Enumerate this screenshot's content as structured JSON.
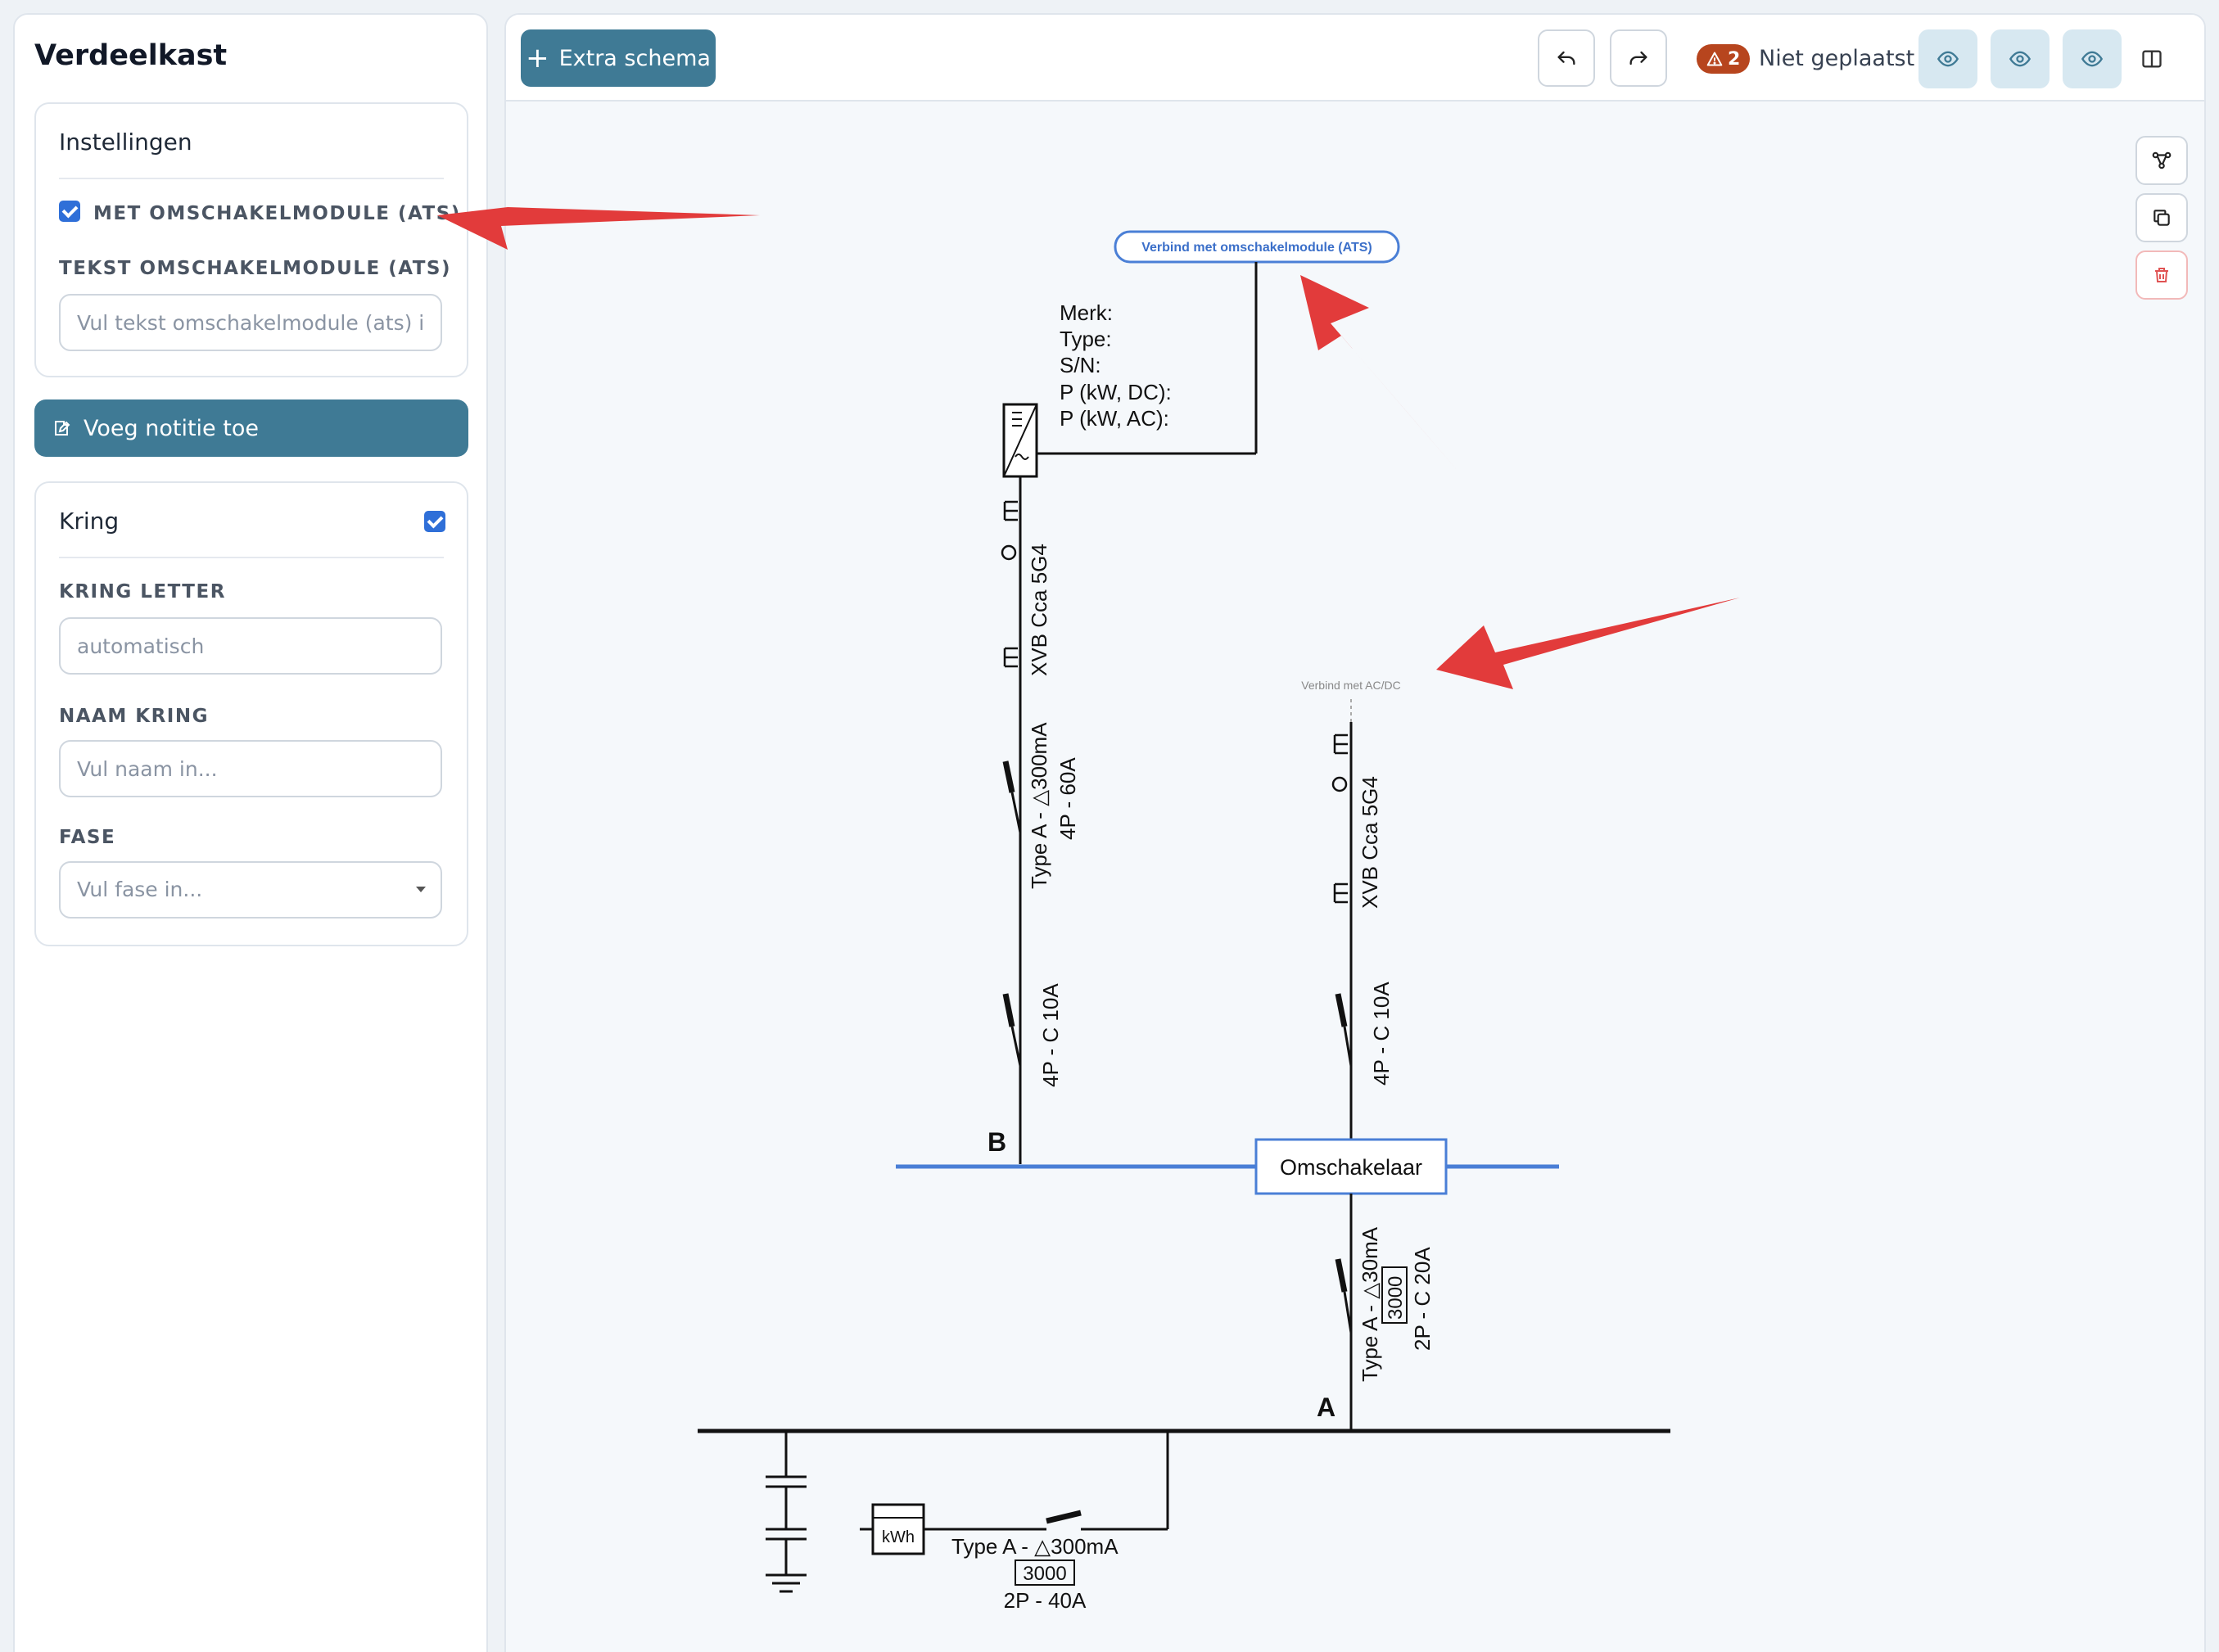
{
  "sidebar": {
    "title": "Verdeelkast",
    "settings_card": {
      "header": "Instellingen",
      "ats_checkbox_label": "MET OMSCHAKELMODULE (ATS)",
      "ats_checked": true,
      "ats_text_label": "TEKST OMSCHAKELMODULE (ATS)",
      "ats_text_placeholder": "Vul tekst omschakelmodule (ats) in...",
      "ats_text_value": ""
    },
    "note_button": "Voeg notitie toe",
    "kring_card": {
      "header": "Kring",
      "checked": true,
      "letter_label": "KRING LETTER",
      "letter_placeholder": "automatisch",
      "name_label": "NAAM KRING",
      "name_placeholder": "Vul naam in...",
      "phase_label": "FASE",
      "phase_placeholder": "Vul fase in..."
    }
  },
  "toolbar": {
    "extra_schema_label": "Extra schema",
    "warning_count": "2",
    "warning_text": "Niet geplaatst"
  },
  "colors": {
    "accent": "#3f7a95",
    "busbar_blue": "#4a7fd6",
    "warning": "#b7451e",
    "arrow_red": "#e23b3b",
    "eye_btn_bg": "#d7e8f1"
  },
  "icons": {
    "undo": "undo-icon",
    "redo": "redo-icon",
    "eye": "eye-icon",
    "panel": "split-panel-icon",
    "connect": "connect-nodes-icon",
    "copy": "copy-icon",
    "trash": "trash-icon",
    "note": "edit-note-icon",
    "warning": "warning-triangle-icon"
  },
  "schematic": {
    "ats_connect_label": "Verbind met omschakelmodule (ATS)",
    "acdc_connect_label": "Verbind met AC/DC",
    "inverter_specs": [
      "Merk:",
      "Type:",
      "S/N:",
      "P (kW, DC):",
      "P (kW, AC):"
    ],
    "cable_left": "XVB Cca 5G4",
    "cable_right": "XVB Cca 5G4",
    "rcd_left_line1": "Type A -  △300mA",
    "rcd_left_line2": "4P - 60A",
    "mcb_left": "4P - C 10A",
    "mcb_right": "4P - C 10A",
    "label_b": "B",
    "switch_box": "Omschakelaar",
    "rcd_center_line1": "Type A -  △30mA",
    "rcd_center_box": "3000",
    "rcd_center_line3": "2P - C 20A",
    "label_a": "A",
    "kwh_label": "kWh",
    "rcd_main_line1": "Type A -   △300mA",
    "rcd_main_box": "3000",
    "rcd_main_line3": "2P - 40A"
  }
}
